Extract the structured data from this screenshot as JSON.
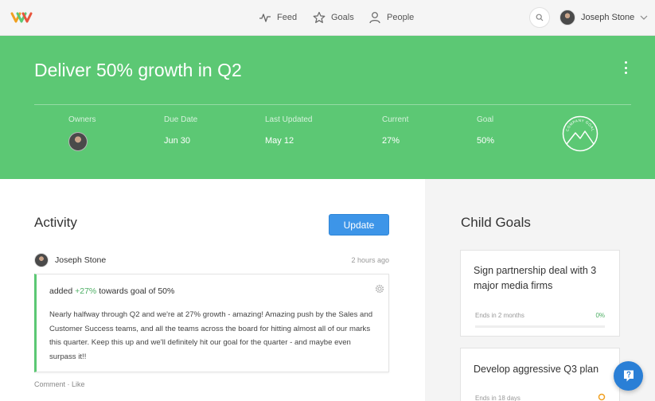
{
  "nav": {
    "items": [
      {
        "label": "Feed",
        "icon": "pulse-icon"
      },
      {
        "label": "Goals",
        "icon": "star-icon"
      },
      {
        "label": "People",
        "icon": "person-icon"
      }
    ],
    "user_name": "Joseph Stone"
  },
  "goal": {
    "title": "Deliver 50% growth in Q2",
    "stats": {
      "owners_label": "Owners",
      "due_label": "Due Date",
      "due_value": "Jun 30",
      "updated_label": "Last Updated",
      "updated_value": "May 12",
      "current_label": "Current",
      "current_value": "27%",
      "goal_label": "Goal",
      "goal_value": "50%"
    },
    "seal_text": "COMPANY GOAL",
    "color": "#5cc874"
  },
  "activity": {
    "title": "Activity",
    "update_label": "Update",
    "post": {
      "author": "Joseph Stone",
      "time": "2 hours ago",
      "added_prefix": "added",
      "added_delta": "+27%",
      "added_middle": "towards goal of",
      "added_goal": "50%",
      "body": "Nearly halfway through Q2 and we're at 27% growth - amazing! Amazing push by the Sales and Customer Success teams, and all the teams across the board for hitting almost all of our marks this quarter. Keep this up and we'll definitely hit our goal for the quarter - and maybe even surpass it!!",
      "comment_label": "Comment",
      "separator": "·",
      "like_label": "Like"
    }
  },
  "child_goals": {
    "title": "Child Goals",
    "items": [
      {
        "title": "Sign partnership deal with 3 major media firms",
        "ends": "Ends in 2 months",
        "percent": "0%",
        "progress": 0
      },
      {
        "title": "Develop aggressive Q3 plan",
        "ends": "Ends in 18 days",
        "percent": "",
        "progress": 0
      }
    ]
  },
  "colors": {
    "accent_green": "#5cc874",
    "button_blue": "#3d95e8",
    "help_blue": "#2a7fd6",
    "warning_orange": "#f0a020"
  }
}
